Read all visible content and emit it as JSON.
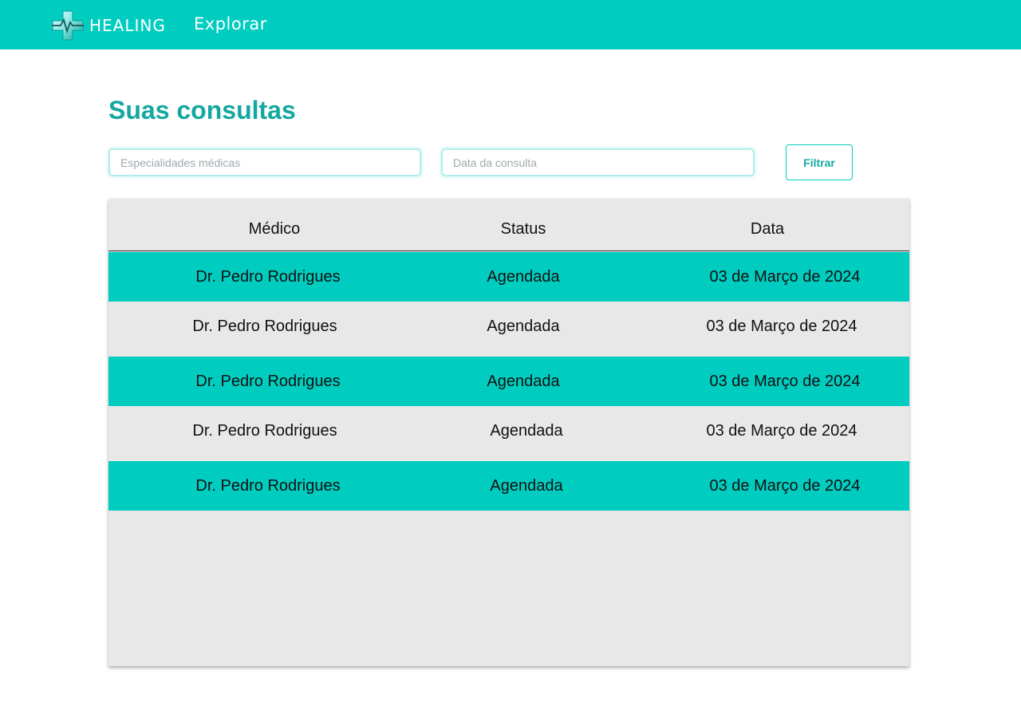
{
  "header": {
    "brand": "HEALING",
    "nav_link": "Explorar"
  },
  "main": {
    "title": "Suas consultas",
    "filters": {
      "specialty_placeholder": "Especialidades médicas",
      "specialty_value": "",
      "date_placeholder": "Data da consulta",
      "date_value": "",
      "filter_button": "Filtrar"
    },
    "table": {
      "columns": [
        "Médico",
        "Status",
        "Data"
      ],
      "rows": [
        {
          "doctor": "Dr. Pedro Rodrigues",
          "status": "Agendada",
          "date": "03 de Março de 2024"
        },
        {
          "doctor": "Dr. Pedro Rodrigues",
          "status": "Agendada",
          "date": "03 de Março de 2024"
        },
        {
          "doctor": "Dr. Pedro Rodrigues",
          "status": "Agendada",
          "date": "03 de Março de 2024"
        },
        {
          "doctor": "Dr. Pedro Rodrigues",
          "status": "Agendada",
          "date": "03 de Março de 2024"
        },
        {
          "doctor": "Dr. Pedro Rodrigues",
          "status": "Agendada",
          "date": "03 de Março de 2024"
        }
      ]
    }
  },
  "colors": {
    "accent": "#00cdc0",
    "title": "#13a8a0",
    "table_background": "#e8e8e8",
    "text": "#111111"
  },
  "icons": {
    "logo": "medical-cross-heartbeat-icon"
  }
}
